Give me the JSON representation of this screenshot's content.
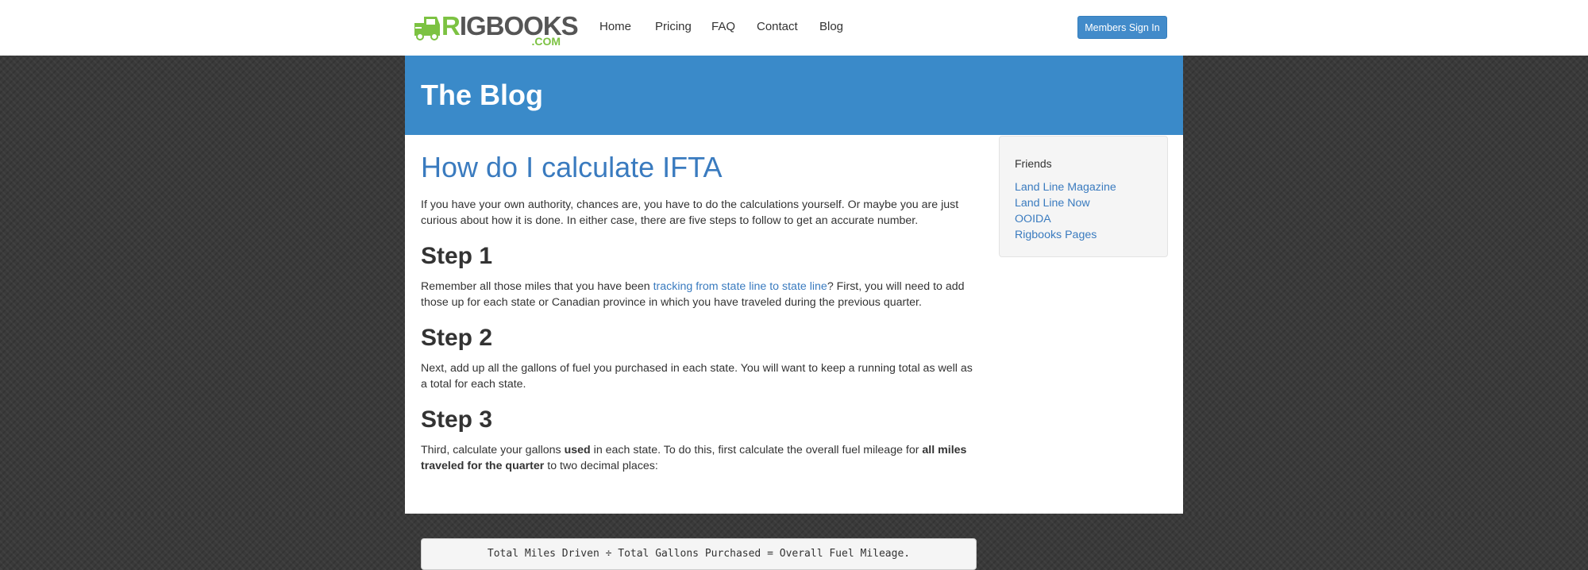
{
  "brand": {
    "logo_text_highlight": "R",
    "logo_text_rest": "IGBOOKS",
    "logo_suffix": ".COM",
    "colors": {
      "green": "#7cc242",
      "gray": "#555555"
    }
  },
  "nav": {
    "items": [
      {
        "label": "Home"
      },
      {
        "label": "Pricing"
      },
      {
        "label": "FAQ"
      },
      {
        "label": "Contact"
      },
      {
        "label": "Blog"
      }
    ],
    "signin_label": "Members Sign In"
  },
  "banner": {
    "title": "The Blog",
    "color": "#3a8ac9"
  },
  "article": {
    "title": "How do I calculate IFTA",
    "intro": "If you have your own authority, chances are, you have to do the calculations yourself. Or maybe you are just curious about how it is done. In either case, there are five steps to follow to get an accurate number.",
    "step1": {
      "heading": "Step 1",
      "text_before": "Remember all those miles that you have been ",
      "link_text": "tracking from state line to state line",
      "text_after": "? First, you will need to add those up for each state or Canadian province in which you have traveled during the previous quarter."
    },
    "step2": {
      "heading": "Step 2",
      "text": "Next, add up all the gallons of fuel you purchased in each state. You will want to keep a running total as well as a total for each state."
    },
    "step3": {
      "heading": "Step 3",
      "text_a": "Third, calculate your gallons ",
      "bold_a": "used",
      "text_b": " in each state. To do this, first calculate the overall fuel mileage for ",
      "bold_b": "all miles traveled for the quarter",
      "text_c": " to two decimal places:",
      "formula": "Total Miles Driven ÷ Total Gallons Purchased = Overall Fuel Mileage."
    }
  },
  "sidebar": {
    "heading": "Friends",
    "links": [
      {
        "label": "Land Line Magazine"
      },
      {
        "label": "Land Line Now"
      },
      {
        "label": "OOIDA"
      },
      {
        "label": "Rigbooks Pages"
      }
    ]
  }
}
